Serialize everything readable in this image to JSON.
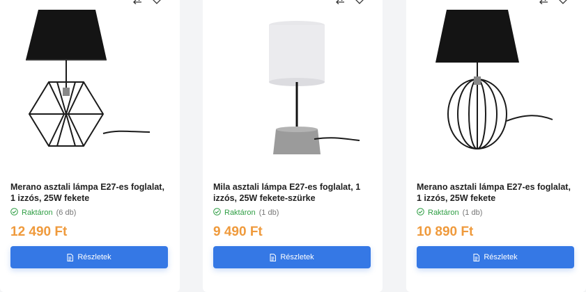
{
  "products": [
    {
      "title": "Merano asztali lámpa E27-es foglalat, 1 izzós, 25W fekete",
      "stock_label": "Raktáron",
      "stock_qty": "(6 db)",
      "price": "12 490 Ft",
      "button_label": "Részletek",
      "image": "merano-black-geometric-lamp"
    },
    {
      "title": "Mila asztali lámpa E27-es foglalat, 1 izzós, 25W fekete-szürke",
      "stock_label": "Raktáron",
      "stock_qty": "(1 db)",
      "price": "9 490 Ft",
      "button_label": "Részletek",
      "image": "mila-white-cylinder-lamp"
    },
    {
      "title": "Merano asztali lámpa E27-es foglalat, 1 izzós, 25W fekete",
      "stock_label": "Raktáron",
      "stock_qty": "(1 db)",
      "price": "10 890 Ft",
      "button_label": "Részletek",
      "image": "merano-black-cage-lamp"
    }
  ],
  "colors": {
    "price": "#ef9a3c",
    "button": "#3578e5",
    "in_stock": "#2f9e44"
  },
  "icons": [
    "compare-icon",
    "heart-icon",
    "check-circle-icon",
    "document-icon"
  ]
}
